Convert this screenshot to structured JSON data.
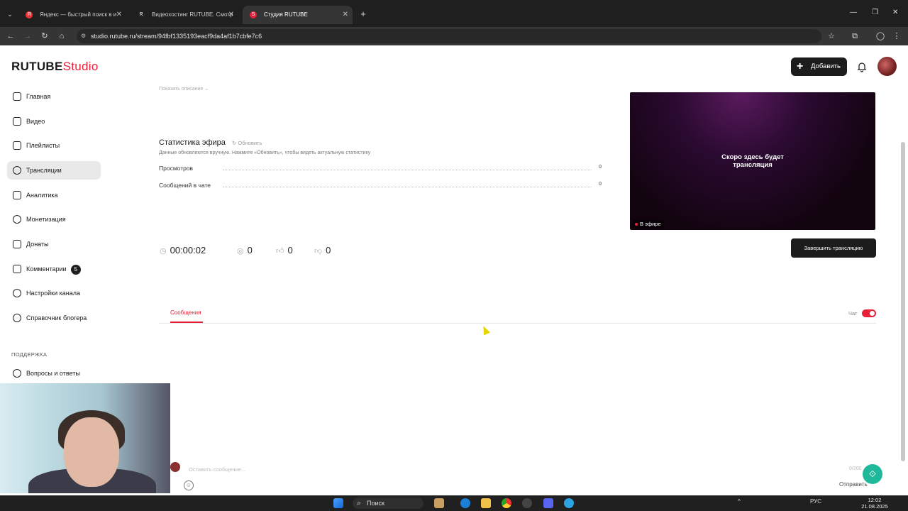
{
  "browser": {
    "tabs": [
      {
        "label": "Яндекс — быстрый поиск в и",
        "favicon": "yandex-icon"
      },
      {
        "label": "Видеохостинг RUTUBE. Смотр",
        "favicon": "rutube-icon"
      },
      {
        "label": "Студия RUTUBE",
        "favicon": "rutube-studio-icon"
      }
    ],
    "url": "studio.rutube.ru/stream/94fbf1335193eacf9da4af1b7cbfe7c6"
  },
  "app": {
    "logo_main": "RUTUBE",
    "logo_studio": "Studio",
    "add_button": "Добавить"
  },
  "sidebar": {
    "items": [
      {
        "label": "Главная",
        "icon": "home-icon"
      },
      {
        "label": "Видео",
        "icon": "video-icon"
      },
      {
        "label": "Плейлисты",
        "icon": "playlist-icon"
      },
      {
        "label": "Трансляции",
        "icon": "broadcast-icon",
        "active": true
      },
      {
        "label": "Аналитика",
        "icon": "analytics-icon"
      },
      {
        "label": "Монетизация",
        "icon": "money-icon"
      },
      {
        "label": "Донаты",
        "icon": "donate-icon"
      },
      {
        "label": "Комментарии",
        "icon": "comments-icon",
        "badge": "5"
      },
      {
        "label": "Настройки канала",
        "icon": "gear-icon"
      },
      {
        "label": "Справочник блогера",
        "icon": "info-icon"
      }
    ],
    "support_heading": "ПОДДЕРЖКА",
    "support_items": [
      {
        "label": "Вопросы и ответы",
        "icon": "question-icon"
      }
    ]
  },
  "stream": {
    "show_description": "Показать описание",
    "stats_title": "Статистика эфира",
    "refresh": "Обновить",
    "stats_note": "Данные обновляются вручную. Нажмите «Обновить», чтобы видеть актуальную статистику",
    "stats": [
      {
        "label": "Просмотров",
        "value": "0"
      },
      {
        "label": "Сообщений в чате",
        "value": "0"
      }
    ],
    "preview_text_1": "Скоро здесь будет",
    "preview_text_2": "трансляция",
    "live_badge": "В эфире",
    "timer": "00:00:02",
    "viewers": "0",
    "likes": "0",
    "dislikes": "0",
    "end_button": "Завершить трансляцию"
  },
  "chat": {
    "tab_messages": "Сообщения",
    "chat_label": "Чат",
    "chat_enabled": true,
    "input_placeholder": "Оставить сообщение...",
    "counter": "0/200",
    "send": "Отправить"
  },
  "taskbar": {
    "search": "Поиск",
    "lang": "РУС",
    "time": "12:02",
    "date": "21.08.2025"
  },
  "colors": {
    "accent": "#e8203a",
    "dark": "#1c1c1c",
    "support_fab": "#1fb89a"
  }
}
